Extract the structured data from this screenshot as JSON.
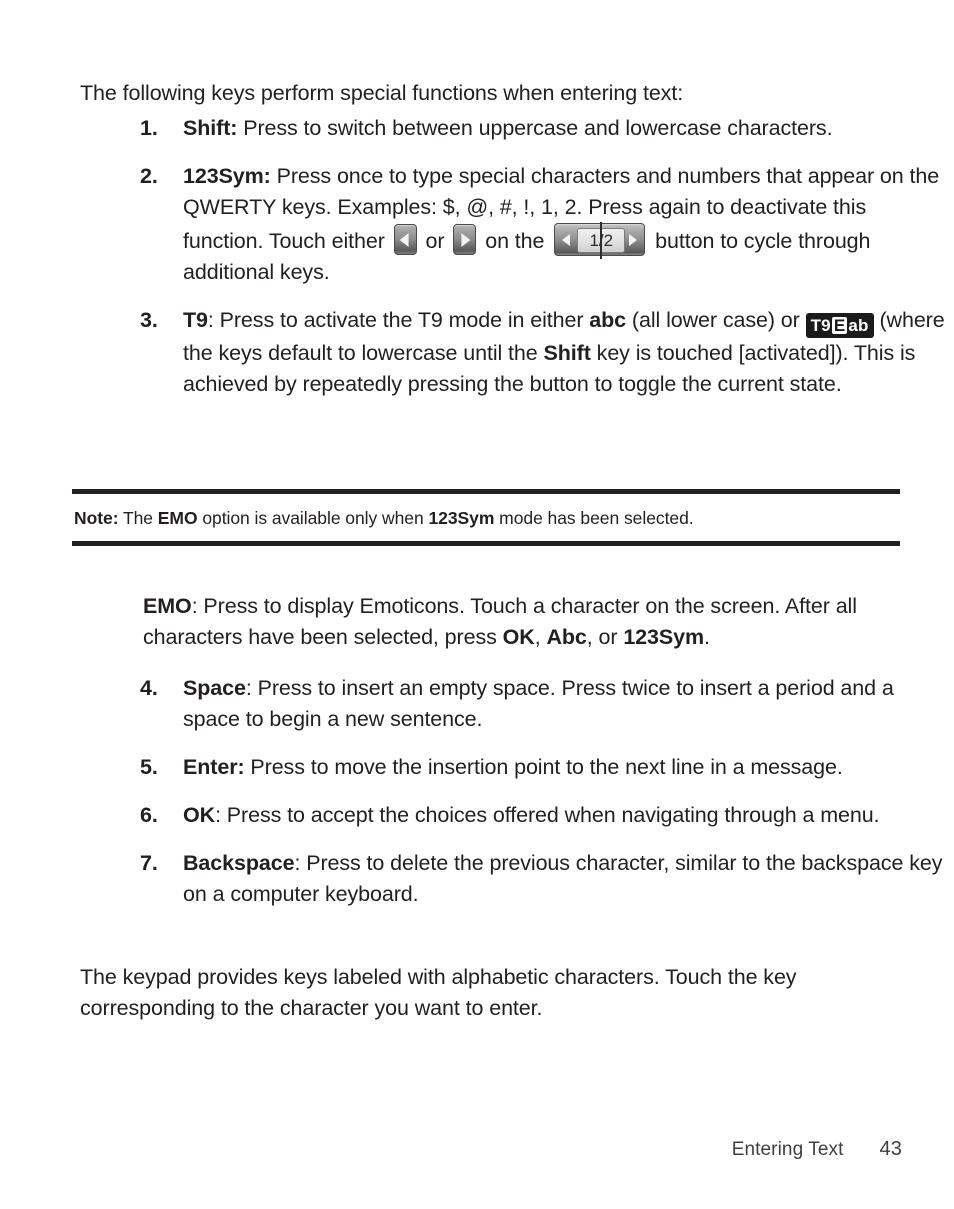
{
  "document": {
    "intro_paragraph": "The following keys perform special functions when entering text:",
    "closing_paragraph": "The keypad provides keys labeled with alphabetic characters. Touch the key corresponding to the character you want to enter."
  },
  "list_first": [
    {
      "number": "1.",
      "term": "Shift:",
      "text_after": " Press to switch between uppercase and lowercase characters."
    },
    {
      "number": "2.",
      "term": "123Sym:",
      "text_part1": " Press once to type special characters and numbers that appear on the QWERTY keys. Examples: $, @, #, !, 1, 2. Press again to deactivate this function. Touch either ",
      "text_part2": " or ",
      "text_part3": " on the ",
      "text_part4": " button to cycle through additional keys.",
      "page_button_label": "1/2"
    },
    {
      "number": "3.",
      "term": "T9",
      "text_part1": ": Press to activate the T9 mode in either ",
      "inline_bold_1": "abc",
      "text_part2": " (all lower case) or ",
      "badge": {
        "prefix": "T9",
        "boxed": "E",
        "suffix": "ab"
      },
      "text_part3": " (where the keys default to lowercase until the ",
      "inline_bold_2": "Shift",
      "text_part4": " key is touched [activated]). This is achieved by repeatedly pressing the button to toggle the current state."
    }
  ],
  "note": {
    "label": "Note:",
    "text_part1": " The ",
    "bold_1": "EMO",
    "text_part2": " option is available only when ",
    "bold_2": "123Sym",
    "text_part3": " mode has been selected."
  },
  "emo_paragraph": {
    "term": "EMO",
    "text_part1": ": Press to display Emoticons. Touch a character on the screen. After all characters have been selected, press ",
    "bold_1": "OK",
    "text_part2": ", ",
    "bold_2": "Abc",
    "text_part3": ", or ",
    "bold_3": "123Sym",
    "text_part4": "."
  },
  "list_second": [
    {
      "number": "4.",
      "term": "Space",
      "text_after": ": Press to insert an empty space. Press twice to insert a period and a space to begin a new sentence."
    },
    {
      "number": "5.",
      "term": "Enter:",
      "text_after": " Press to move the insertion point to the next line in a message."
    },
    {
      "number": "6.",
      "term": "OK",
      "text_after": ": Press to accept the choices offered when navigating through a menu."
    },
    {
      "number": "7.",
      "term": "Backspace",
      "text_after": ": Press to delete the previous character, similar to the backspace key on a computer keyboard."
    }
  ],
  "footer": {
    "chapter": "Entering Text",
    "page_number": "43"
  },
  "colors": {
    "text": "#231f20",
    "footer_text": "#3f3f3f",
    "rule": "#231f20",
    "badge_background": "#1b1b1b"
  },
  "icons": {
    "left_arrow": "arrow-left-icon",
    "right_arrow": "arrow-right-icon"
  }
}
